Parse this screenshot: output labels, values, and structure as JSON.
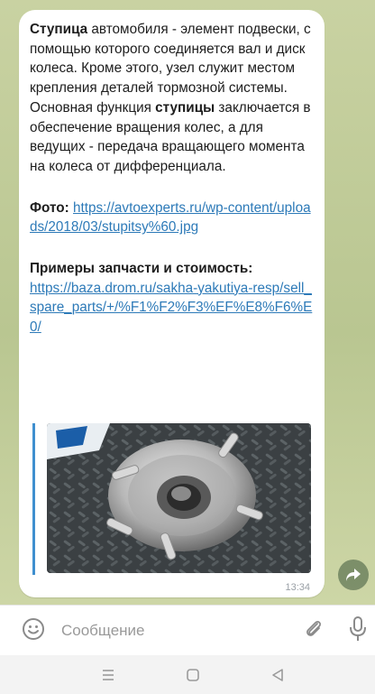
{
  "message": {
    "p1_bold1": "Ступица",
    "p1_rest1": " автомобиля - элемент подвески, с помощью которого соединяется вал и диск колеса. Кроме этого, узел служит местом крепления деталей тормозной системы. Основная функция ",
    "p1_bold2": "ступицы",
    "p1_rest2": " заключается в обеспечение вращения колес, а для ведущих - передача вращающего момента на колеса от дифференциала.",
    "photo_label": "Фото:",
    "photo_url": "https://avtoexperts.ru/wp-content/uploads/2018/03/stupitsy%60.jpg",
    "parts_label": "Примеры запчасти и стоимость:",
    "parts_url": "https://baza.drom.ru/sakha-yakutiya-resp/sell_spare_parts/+/%F1%F2%F3%EF%E8%F6%E0/",
    "time": "13:34"
  },
  "input": {
    "placeholder": "Сообщение"
  }
}
